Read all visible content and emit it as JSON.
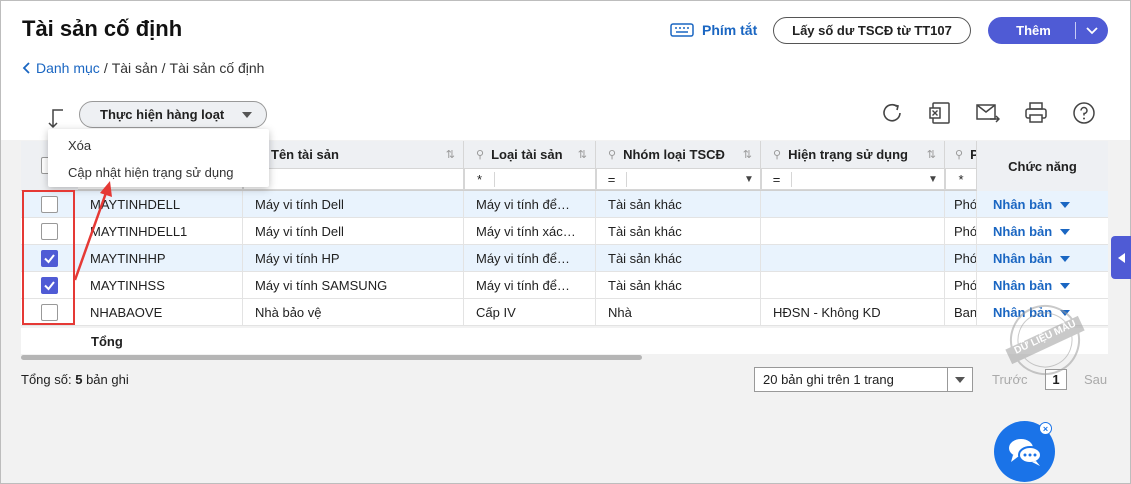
{
  "page": {
    "title": "Tài sản cố định"
  },
  "breadcrumb": {
    "items": [
      "Danh mục",
      "Tài sản",
      "Tài sản cố định"
    ],
    "separator": "/"
  },
  "header": {
    "hotkey_label": "Phím tắt",
    "import_label": "Lấy số dư TSCĐ từ TT107",
    "add_label": "Thêm"
  },
  "toolbar": {
    "bulk_label": "Thực hiện hàng loạt",
    "bulk_menu": [
      "Xóa",
      "Cập nhật hiện trạng sử dụng"
    ]
  },
  "table": {
    "columns": [
      "Tên tài sản",
      "Loại tài sản",
      "Nhóm loại TSCĐ",
      "Hiện trạng sử dụng",
      "P",
      "Chức năng"
    ],
    "filter_ops": [
      "*",
      "*",
      "=",
      "=",
      "*"
    ],
    "rows": [
      {
        "code": "MAYTINHDELL",
        "name": "Máy vi tính Dell",
        "type": "Máy vi tính để…",
        "group": "Tài sản khác",
        "status": "",
        "p": "Phó",
        "action": "Nhân bản",
        "checked": false,
        "highlight": true
      },
      {
        "code": "MAYTINHDELL1",
        "name": "Máy vi tính Dell",
        "type": "Máy vi tính xác…",
        "group": "Tài sản khác",
        "status": "",
        "p": "Phó",
        "action": "Nhân bản",
        "checked": false,
        "highlight": false
      },
      {
        "code": "MAYTINHHP",
        "name": "Máy vi tính HP",
        "type": "Máy vi tính để…",
        "group": "Tài sản khác",
        "status": "",
        "p": "Phó",
        "action": "Nhân bản",
        "checked": true,
        "highlight": true
      },
      {
        "code": "MAYTINHSS",
        "name": "Máy vi tính SAMSUNG",
        "type": "Máy vi tính để…",
        "group": "Tài sản khác",
        "status": "",
        "p": "Phó",
        "action": "Nhân bản",
        "checked": true,
        "highlight": false
      },
      {
        "code": "NHABAOVE",
        "name": "Nhà bảo vệ",
        "type": "Cấp IV",
        "group": "Nhà",
        "status": "HĐSN - Không KD",
        "p": "Ban",
        "action": "Nhân bản",
        "checked": false,
        "highlight": false
      }
    ],
    "total_label": "Tổng"
  },
  "footer": {
    "total_prefix": "Tổng số:",
    "total_count": "5",
    "total_suffix": "bản ghi",
    "page_size": "20 bản ghi trên 1 trang",
    "prev": "Trước",
    "page": "1",
    "next": "Sau"
  },
  "watermark": "DỮ LIỆU MẪU",
  "colors": {
    "primary": "#4f5bd5",
    "link": "#1a66c2",
    "highlight": "#e53935"
  }
}
